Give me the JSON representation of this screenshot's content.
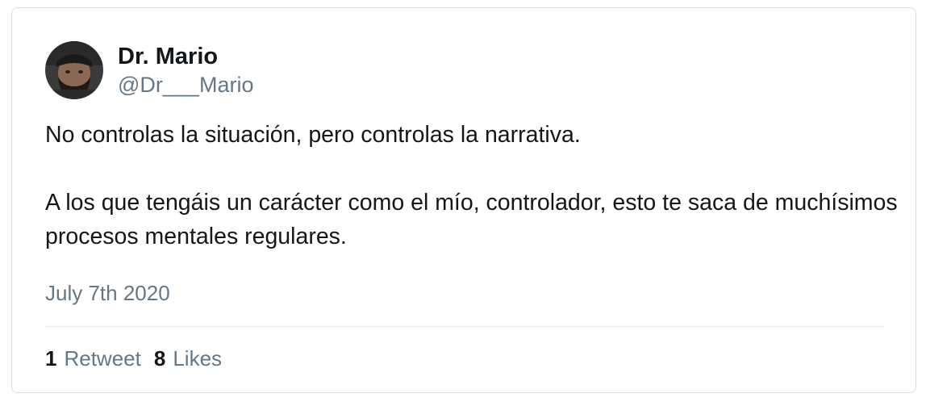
{
  "author": {
    "display_name": "Dr. Mario",
    "handle": "@Dr___Mario",
    "avatar_icon": "profile-photo"
  },
  "tweet": {
    "paragraphs": [
      "No controlas la situación, pero controlas la narrativa.",
      "A los que tengáis un carácter como el mío, controlador, esto te saca de muchísimos procesos mentales regulares."
    ],
    "date": "July 7th 2020"
  },
  "stats": {
    "retweets": {
      "count": "1",
      "label": "Retweet"
    },
    "likes": {
      "count": "8",
      "label": "Likes"
    }
  },
  "colors": {
    "text_primary": "#14171a",
    "text_secondary": "#657786",
    "border": "#d9dde1",
    "divider": "#e1e8ed"
  }
}
